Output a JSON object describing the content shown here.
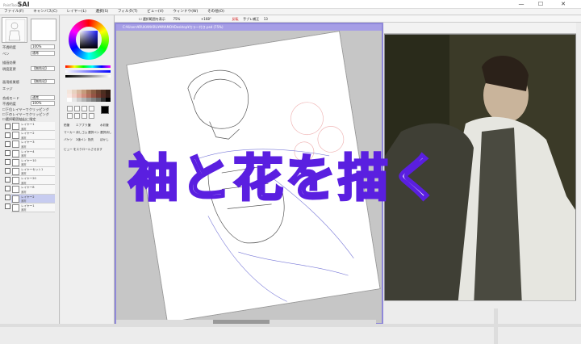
{
  "app": {
    "logo": "SAI",
    "logo_sub": "PaintTool",
    "window_min": "—",
    "window_max": "☐",
    "window_close": "✕"
  },
  "menu": [
    "ファイル(F)",
    "キャンバス(C)",
    "レイヤー(L)",
    "選択(S)",
    "フィルタ(T)",
    "ビュー(V)",
    "ウィンドウ(W)",
    "その他(O)"
  ],
  "toolbar": {
    "selection_source": "選択範囲を表示",
    "zoom": "75%",
    "rotation": "+168°",
    "invert": "反転",
    "stabilizer_label": "手ブレ補正",
    "stabilizer_value": "13"
  },
  "left_panel": {
    "options": [
      {
        "label": "不透明度",
        "value": "100%"
      },
      {
        "label": "ペン",
        "value": "通常"
      },
      {
        "label": "描画効果",
        "value": ""
      },
      {
        "label": "明度変更",
        "value": "【無効化】"
      },
      {
        "label": "",
        "value": ""
      },
      {
        "label": "画用紙質感",
        "value": "【無効化】"
      },
      {
        "label": "エッジ",
        "value": ""
      }
    ],
    "blend_mode_label": "合成モード",
    "blend_mode_value": "通常",
    "opacity_label": "不透明度",
    "opacity_value": "100%",
    "checks": [
      "下位レイヤーでクリッピング",
      "下のレイヤーでクリッピング",
      "選択範囲抽出に指定"
    ]
  },
  "layers": [
    {
      "name": "レイヤー1",
      "mode": "通常",
      "selected": false
    },
    {
      "name": "レイヤー2",
      "mode": "通常",
      "selected": false
    },
    {
      "name": "レイヤー3",
      "mode": "通常",
      "selected": false
    },
    {
      "name": "レイヤー4",
      "mode": "通常",
      "selected": false
    },
    {
      "name": "レイヤー10",
      "mode": "通常",
      "selected": false
    },
    {
      "name": "レイヤーセット1",
      "mode": "通常",
      "selected": false
    },
    {
      "name": "レイヤー20",
      "mode": "通常",
      "selected": false
    },
    {
      "name": "レイヤー8",
      "mode": "通常",
      "selected": false
    },
    {
      "name": "レイヤー2",
      "mode": "通常",
      "selected": true
    },
    {
      "name": "レイヤー1",
      "mode": "通常",
      "selected": false
    }
  ],
  "tools": {
    "grid": [
      "鉛筆",
      "エアブラシ",
      "筆",
      "水彩筆",
      "マーカー",
      "消しゴム",
      "選択ペン",
      "選択消し",
      "バケツ",
      "2値ペン",
      "指先",
      "ぼかし"
    ],
    "hint": "ビュー をスクロールさせます"
  },
  "palette": [
    "#f4e6dc",
    "#e8d2c0",
    "#d9b9a0",
    "#c59b7c",
    "#a9785a",
    "#8a5c42",
    "#6b4330",
    "#4c2e20",
    "#2f1b12",
    "#f9e8e3",
    "#f0cfc6",
    "#e3afa1",
    "#d08f7f",
    "#b5705f",
    "#955445",
    "#743d31",
    "#522a22",
    "#331a15",
    "#ffffff",
    "#e6e6e6",
    "#cccccc",
    "#b3b3b3",
    "#999999",
    "#808080",
    "#666666",
    "#333333",
    "#000000"
  ],
  "canvas": {
    "title": "C:¥Users¥RUKAMARU¥¥MAMO¥Desktop¥カラー付き.psd (75%)"
  },
  "overlay_text": "袖と花を描く",
  "colors": {
    "accent": "#8f88d9",
    "overlay_stroke": "#5a1fe0",
    "selected_layer": "#c7ccf0"
  }
}
